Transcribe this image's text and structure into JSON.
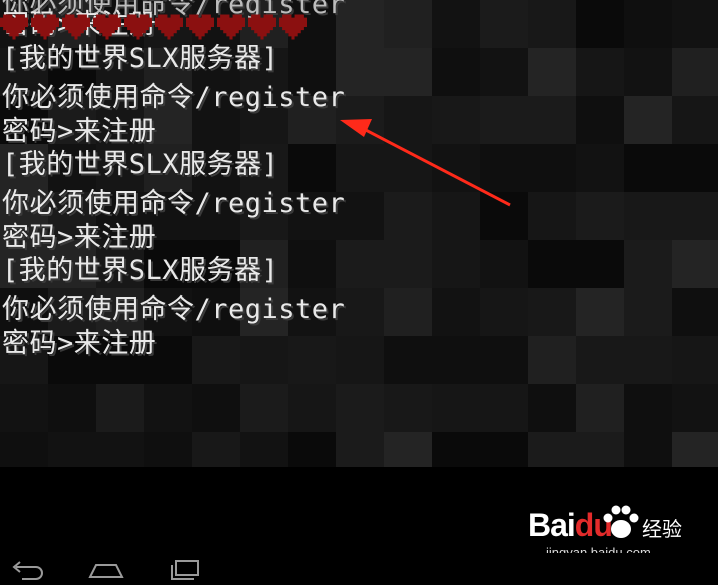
{
  "chat": {
    "lines": [
      "你必须使用命令/register",
      "密码>来注册",
      "[我的世界SLX服务器]",
      "你必须使用命令/register",
      "密码>来注册",
      "[我的世界SLX服务器]",
      "你必须使用命令/register",
      "密码>来注册",
      "[我的世界SLX服务器]",
      "你必须使用命令/register",
      "密码>来注册"
    ]
  },
  "hud": {
    "heart_color": "#8b1010",
    "hearts_visible": 10
  },
  "annotation": {
    "arrow_color": "#ff2a1a"
  },
  "watermark": {
    "brand": "Bai",
    "brand_accent": "du",
    "suffix": "经验",
    "url": "jingyan.baidu.com"
  },
  "navbar": {
    "icons": [
      "back-icon",
      "home-icon",
      "recents-icon"
    ]
  }
}
